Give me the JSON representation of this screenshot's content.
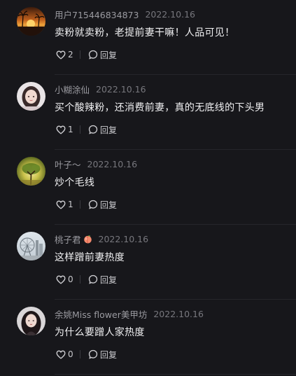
{
  "comments": [
    {
      "username": "用户715446834873",
      "date": "2022.10.16",
      "text": "卖粉就卖粉，老提前妻干嘛！人品可见！",
      "like_count": "2",
      "reply_label": "回复",
      "avatar": "sunset-avatar"
    },
    {
      "username": "小糊涂仙",
      "date": "2022.10.16",
      "text": "买个酸辣粉，还消费前妻，真的无底线的下头男",
      "like_count": "1",
      "reply_label": "回复",
      "avatar": "portrait-avatar"
    },
    {
      "username": "叶子～",
      "date": "2022.10.16",
      "text": "炒个毛线",
      "like_count": "1",
      "reply_label": "回复",
      "avatar": "tree-avatar"
    },
    {
      "username": "桃子君",
      "username_emoji": "peach-icon",
      "date": "2022.10.16",
      "text": "这样蹭前妻热度",
      "like_count": "0",
      "reply_label": "回复",
      "avatar": "ferris-wheel-avatar"
    },
    {
      "username": "余姚Miss flower美甲坊",
      "date": "2022.10.16",
      "text": "为什么要蹭人家热度",
      "like_count": "0",
      "reply_label": "回复",
      "avatar": "woman-avatar"
    }
  ],
  "colors": {
    "background": "#17171b",
    "username": "#9a9aa0",
    "date": "#77777d",
    "content": "#f0f0f2"
  }
}
